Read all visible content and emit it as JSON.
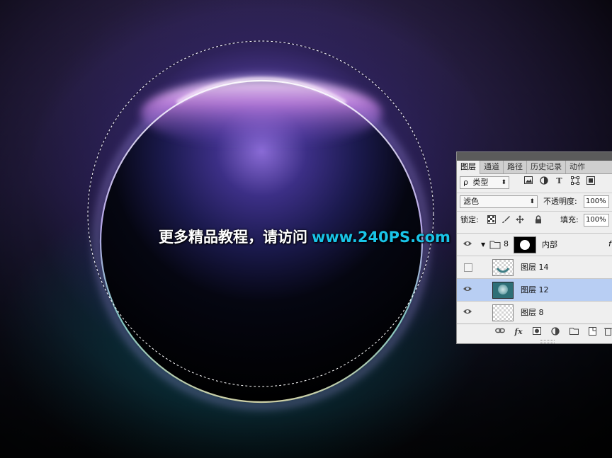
{
  "watermark": {
    "text_cn": "更多精品教程，请访问",
    "url": "www.240PS.com"
  },
  "layers_panel": {
    "tabs": [
      {
        "label": "图层",
        "active": true
      },
      {
        "label": "通道",
        "active": false
      },
      {
        "label": "路径",
        "active": false
      },
      {
        "label": "历史记录",
        "active": false
      },
      {
        "label": "动作",
        "active": false
      }
    ],
    "filter": {
      "search_glyph": "ρ",
      "kind_label": "类型"
    },
    "filter_icons": [
      "image-filter-icon",
      "adjustment-filter-icon",
      "text-filter-icon",
      "shape-filter-icon",
      "smart-object-filter-icon"
    ],
    "blend_mode": "滤色",
    "opacity_label": "不透明度:",
    "opacity_value": "100%",
    "lock_label": "锁定:",
    "fill_label": "填充:",
    "fill_value": "100%",
    "layers": [
      {
        "name": "内部",
        "type": "group",
        "visible": true,
        "selected": false,
        "link_glyph": "8"
      },
      {
        "name": "图层 14",
        "type": "layer",
        "visible": false,
        "selected": false
      },
      {
        "name": "图层 12",
        "type": "layer",
        "visible": true,
        "selected": true
      },
      {
        "name": "图层 8",
        "type": "layer",
        "visible": true,
        "selected": false
      }
    ],
    "bottom_icons": [
      "link-layers-icon",
      "fx-icon",
      "add-mask-icon",
      "adjustment-layer-icon",
      "new-group-icon",
      "new-layer-icon",
      "delete-layer-icon"
    ],
    "fx_label": "fx"
  },
  "colors": {
    "watermark_url": "#19c4e8",
    "selected_layer": "#b8cef3",
    "panel_bg": "#efefef"
  }
}
